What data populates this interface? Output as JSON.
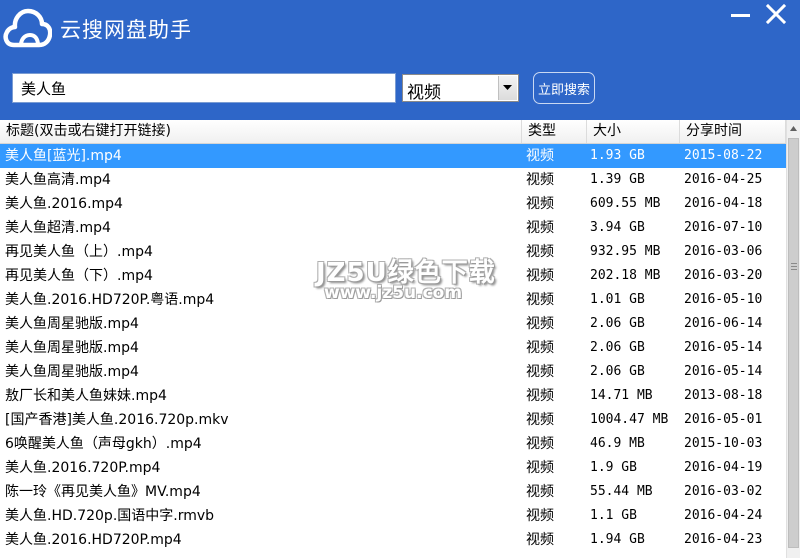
{
  "app": {
    "title": "云搜网盘助手",
    "min_label": "—",
    "close_label": "✕"
  },
  "search": {
    "query": "美人鱼",
    "category_value": "视频",
    "button_label": "立即搜索"
  },
  "table": {
    "columns": {
      "title": "标题(双击或右键打开链接)",
      "type": "类型",
      "size": "大小",
      "date": "分享时间"
    },
    "rows": [
      {
        "title": "美人鱼[蓝光].mp4",
        "type": "视频",
        "size": "1.93 GB",
        "date": "2015-08-22"
      },
      {
        "title": "美人鱼高清.mp4",
        "type": "视频",
        "size": "1.39 GB",
        "date": "2016-04-25"
      },
      {
        "title": "美人鱼.2016.mp4",
        "type": "视频",
        "size": "609.55 MB",
        "date": "2016-04-18"
      },
      {
        "title": "美人鱼超清.mp4",
        "type": "视频",
        "size": "3.94 GB",
        "date": "2016-07-10"
      },
      {
        "title": "再见美人鱼（上）.mp4",
        "type": "视频",
        "size": "932.95 MB",
        "date": "2016-03-06"
      },
      {
        "title": "再见美人鱼（下）.mp4",
        "type": "视频",
        "size": "202.18 MB",
        "date": "2016-03-20"
      },
      {
        "title": "美人鱼.2016.HD720P.粤语.mp4",
        "type": "视频",
        "size": "1.01 GB",
        "date": "2016-05-10"
      },
      {
        "title": "美人鱼周星驰版.mp4",
        "type": "视频",
        "size": "2.06 GB",
        "date": "2016-06-14"
      },
      {
        "title": "美人鱼周星驰版.mp4",
        "type": "视频",
        "size": "2.06 GB",
        "date": "2016-05-14"
      },
      {
        "title": "美人鱼周星驰版.mp4",
        "type": "视频",
        "size": "2.06 GB",
        "date": "2016-05-14"
      },
      {
        "title": "敖厂长和美人鱼妹妹.mp4",
        "type": "视频",
        "size": "14.71 MB",
        "date": "2013-08-18"
      },
      {
        "title": "[国产香港]美人鱼.2016.720p.mkv",
        "type": "视频",
        "size": "1004.47 MB",
        "date": "2016-05-01"
      },
      {
        "title": "6唤醒美人鱼（声母gkh）.mp4",
        "type": "视频",
        "size": "46.9 MB",
        "date": "2015-10-03"
      },
      {
        "title": "美人鱼.2016.720P.mp4",
        "type": "视频",
        "size": "1.9 GB",
        "date": "2016-04-19"
      },
      {
        "title": "陈一玲《再见美人鱼》MV.mp4",
        "type": "视频",
        "size": "55.44 MB",
        "date": "2016-03-02"
      },
      {
        "title": "美人鱼.HD.720p.国语中字.rmvb",
        "type": "视频",
        "size": "1.1 GB",
        "date": "2016-04-24"
      },
      {
        "title": "美人鱼.2016.HD720P.mp4",
        "type": "视频",
        "size": "1.94 GB",
        "date": "2016-04-23"
      }
    ]
  },
  "watermark": {
    "main": "JZ5U绿色下载",
    "sub": "www.jz5u.com"
  },
  "colors": {
    "titlebar": "#2e66c8",
    "selection": "#3399ff"
  }
}
